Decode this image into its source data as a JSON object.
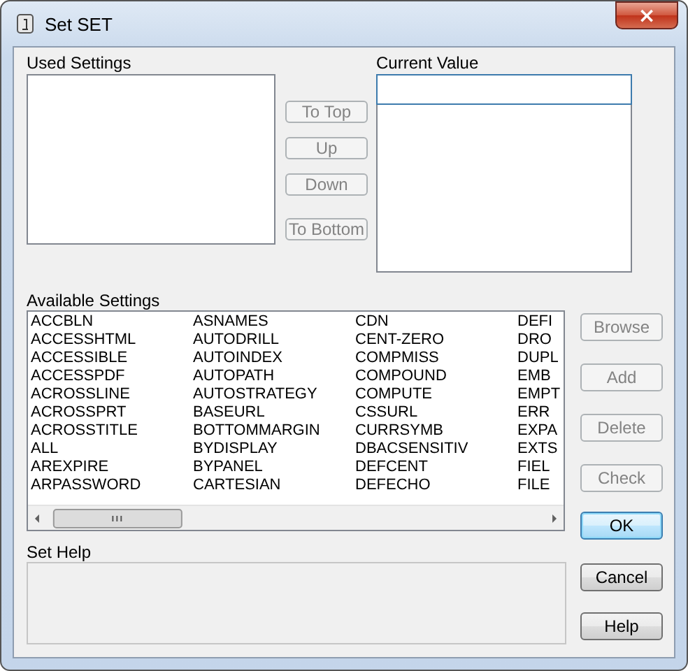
{
  "window": {
    "title": "Set SET",
    "close": "×"
  },
  "used_settings": {
    "label": "Used Settings"
  },
  "order_buttons": [
    {
      "label": "To Top",
      "disabled": true
    },
    {
      "label": "Up",
      "disabled": true
    },
    {
      "label": "Down",
      "disabled": true
    },
    {
      "label": "To Bottom",
      "disabled": true
    }
  ],
  "current_value": {
    "label": "Current Value"
  },
  "available_settings": {
    "label": "Available Settings",
    "columns": [
      [
        "ACCBLN",
        "ACCESSHTML",
        "ACCESSIBLE",
        "ACCESSPDF",
        "ACROSSLINE",
        "ACROSSPRT",
        "ACROSSTITLE",
        "ALL",
        "AREXPIRE",
        "ARPASSWORD"
      ],
      [
        "ASNAMES",
        "AUTODRILL",
        "AUTOINDEX",
        "AUTOPATH",
        "AUTOSTRATEGY",
        "BASEURL",
        "BOTTOMMARGIN",
        "BYDISPLAY",
        "BYPANEL",
        "CARTESIAN"
      ],
      [
        "CDN",
        "CENT-ZERO",
        "COMPMISS",
        "COMPOUND",
        "COMPUTE",
        "CSSURL",
        "CURRSYMB",
        "DBACSENSITIV",
        "DEFCENT",
        "DEFECHO"
      ],
      [
        "DEFI",
        "DRO",
        "DUPL",
        "EMB",
        "EMPT",
        "ERR",
        "EXPA",
        "EXTS",
        "FIEL",
        "FILE"
      ]
    ]
  },
  "set_help": {
    "label": "Set Help"
  },
  "side_buttons": [
    {
      "label": "Browse",
      "disabled": true,
      "default": false
    },
    {
      "label": "Add",
      "disabled": true,
      "default": false
    },
    {
      "label": "Delete",
      "disabled": true,
      "default": false
    },
    {
      "label": "Check",
      "disabled": true,
      "default": false
    },
    {
      "label": "OK",
      "disabled": false,
      "default": true
    },
    {
      "label": "Cancel",
      "disabled": false,
      "default": false
    },
    {
      "label": "Help",
      "disabled": false,
      "default": false
    }
  ]
}
